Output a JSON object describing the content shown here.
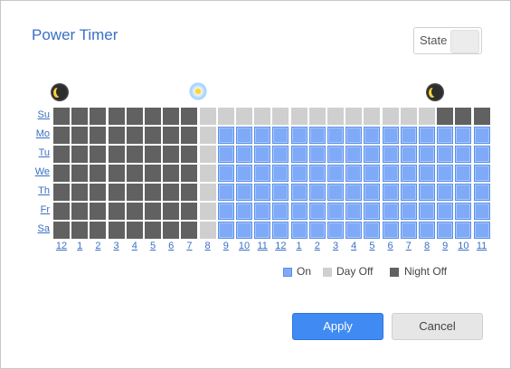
{
  "dialog": {
    "title": "Power Timer",
    "state_label": "State",
    "state_on": false
  },
  "days": [
    "Su",
    "Mo",
    "Tu",
    "We",
    "Th",
    "Fr",
    "Sa"
  ],
  "hours": [
    "12",
    "1",
    "2",
    "3",
    "4",
    "5",
    "6",
    "7",
    "8",
    "9",
    "10",
    "11",
    "12",
    "1",
    "2",
    "3",
    "4",
    "5",
    "6",
    "7",
    "8",
    "9",
    "10",
    "11"
  ],
  "icons": {
    "left": "moon-icon",
    "middle": "sun-icon",
    "right": "moon-icon"
  },
  "schedule_legend": {
    "on": "On",
    "day_off": "Day Off",
    "night_off": "Night Off"
  },
  "colors": {
    "on": "#7eaaf8",
    "day_off": "#cfcfcf",
    "night_off": "#616161",
    "accent": "#3a6fc4",
    "apply": "#3f8bf3"
  },
  "schedule": {
    "Su": "NNNNNNNNDDDDDDDDDDDDDNNN",
    "Mo": "NNNNNNNNDOOOOOOOOOOOOOOO",
    "Tu": "NNNNNNNNDOOOOOOOOOOOOOOO",
    "We": "NNNNNNNNDOOOOOOOOOOOOOOO",
    "Th": "NNNNNNNNDOOOOOOOOOOOOOOO",
    "Fr": "NNNNNNNNDOOOOOOOOOOOOOOO",
    "Sa": "NNNNNNNNDOOOOOOOOOOOOOOO"
  },
  "buttons": {
    "apply": "Apply",
    "cancel": "Cancel"
  }
}
